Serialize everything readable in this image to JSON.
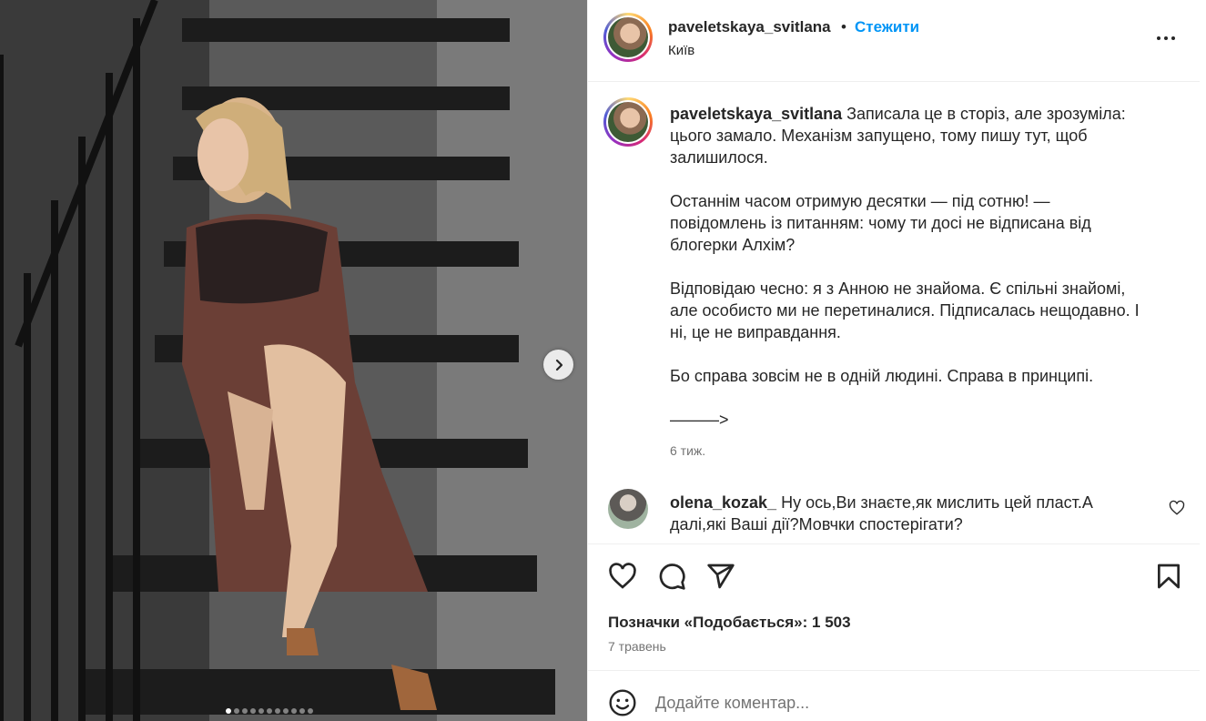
{
  "post": {
    "author": {
      "username": "paveletskaya_svitlana",
      "separator": "•",
      "follow_label": "Стежити",
      "location": "Київ"
    },
    "caption": {
      "username": "paveletskaya_svitlana",
      "paragraphs": [
        "Записала це в сторіз, але зрозуміла: цього замало. Механізм запущено, тому пишу тут, щоб залишилося.",
        "Останнім часом отримую десятки — під сотню! — повідомлень із питанням: чому ти досі не відписана від блогерки Алхім?",
        "Відповідаю чесно: я з Анною не знайома. Є спільні знайомі, але особисто ми не перетиналися. Підписалась нещодавно. І ні, це не виправдання.",
        "Бо справа зовсім не в одній людині. Справа в принципі.",
        "———>"
      ],
      "time": "6 тиж."
    },
    "comments": [
      {
        "username": "olena_kozak_",
        "text": "Ну ось,Ви знаєте,як мислить цей пласт.А далі,які Ваші дії?Мовчки спостерігати?"
      }
    ],
    "likes_text": "Позначки «Подобається»: 1 503",
    "date": "7 травень",
    "add_comment_placeholder": "Додайте коментар...",
    "carousel": {
      "slides": 11,
      "current": 1
    },
    "icons": [
      "more-icon",
      "heart-icon",
      "comment-icon",
      "share-icon",
      "bookmark-icon",
      "emoji-icon",
      "chevron-right-icon",
      "comment-heart-icon"
    ],
    "colors": {
      "accent": "#0095f6",
      "text": "#262626",
      "muted": "#737373",
      "border": "#efefef"
    }
  }
}
